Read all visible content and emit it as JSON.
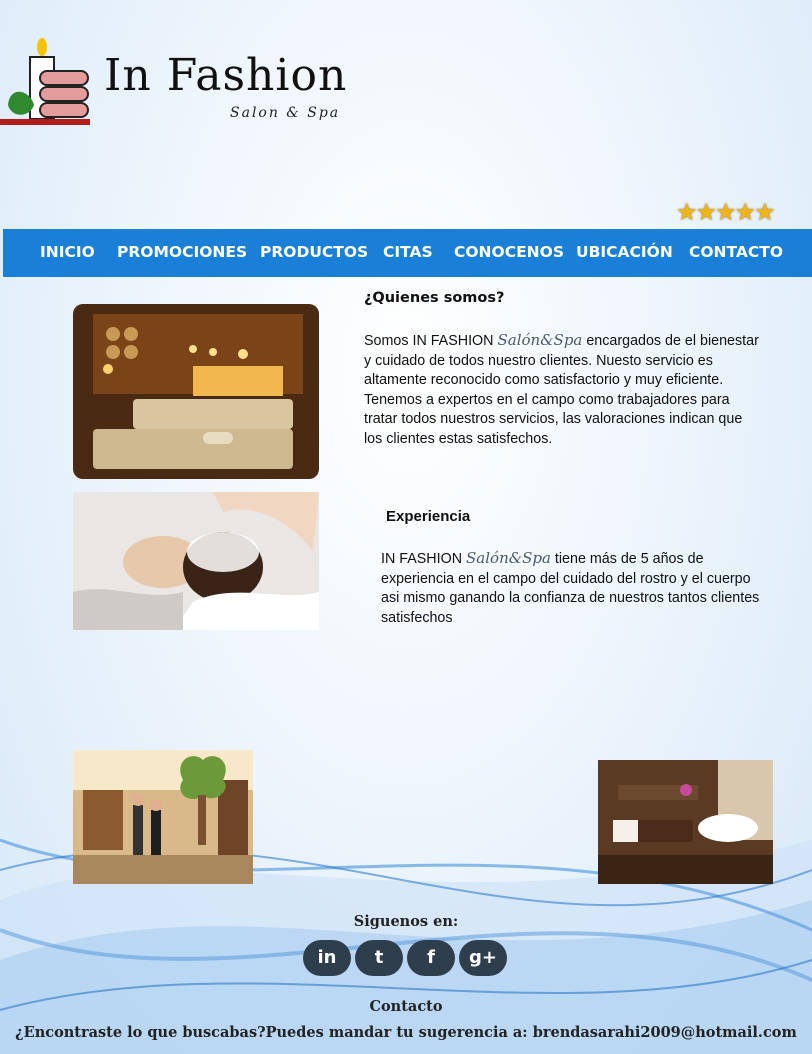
{
  "brand": {
    "title": "In Fashion",
    "subtitle": "Salon & Spa"
  },
  "rating": {
    "stars": 5,
    "display": "★★★★★"
  },
  "nav": {
    "items": [
      "INICIO",
      "PROMOCIONES",
      "PRODUCTOS",
      "CITAS",
      "CONOCENOS",
      "UBICACIÓN",
      "CONTACTO"
    ]
  },
  "about": {
    "heading": "¿Quienes somos?",
    "lead": "Somos IN FASHION",
    "brand_script": "Salón&Spa",
    "body": "encargados de el bienestar y cuidado de todos nuestro clientes. Nuesto servicio es altamente reconocido como satisfactorio y muy eficiente. Tenemos a expertos en el campo como trabajadores para tratar todos nuestros servicios, las valoraciones indican que los clientes estas satisfechos."
  },
  "experience": {
    "heading": "Experiencia",
    "lead": "IN FASHION",
    "brand_script": "Salón&Spa",
    "body": "tiene más de 5 años de experiencia en el campo del cuidado del rostro y el cuerpo asi mismo ganando la confianza de nuestros tantos clientes satisfechos"
  },
  "footer": {
    "follow_label": "Siguenos en:",
    "social": [
      "in",
      "t",
      "f",
      "g+"
    ],
    "social_icons": [
      "linkedin-icon",
      "twitter-icon",
      "facebook-icon",
      "google-plus-icon"
    ],
    "contact_label": "Contacto",
    "suggestion": "¿Encontraste lo que buscabas?Puedes mandar tu sugerencia a: brendasarahi2009@hotmail.com"
  },
  "colors": {
    "nav_bg": "#1a7fd6",
    "social_bg": "#2f3e4c",
    "star": "#f0b418"
  }
}
